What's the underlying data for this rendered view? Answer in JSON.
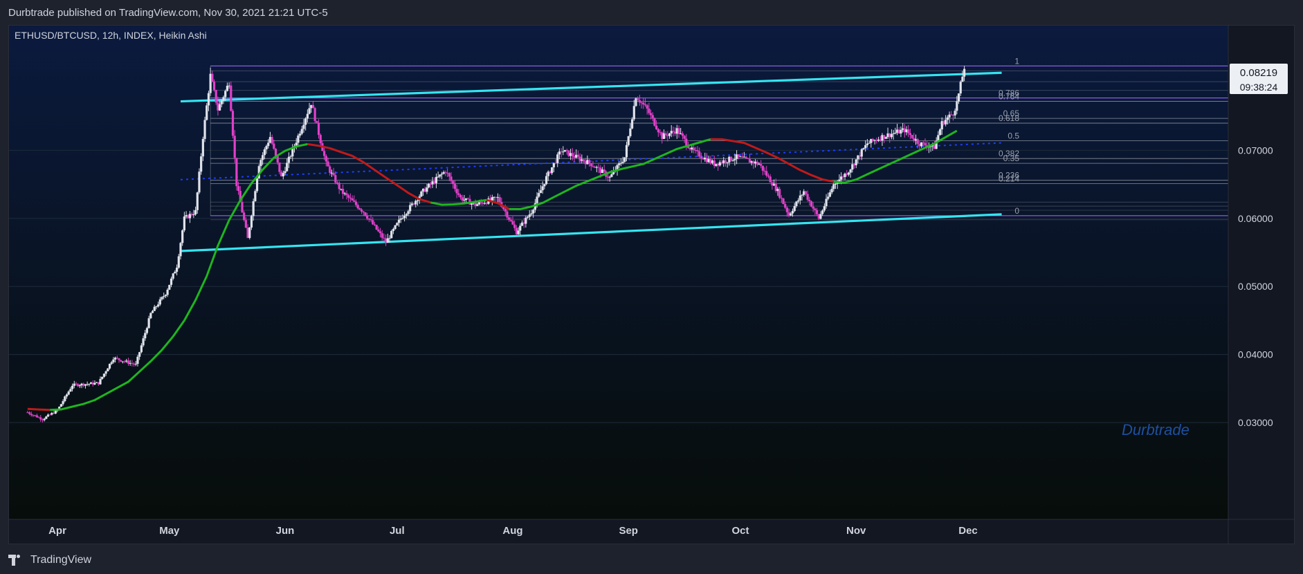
{
  "header": {
    "published": "Durbtrade published on TradingView.com, Nov 30, 2021 21:21 UTC-5"
  },
  "footer": {
    "logo_text": "TradingView"
  },
  "colors": {
    "background_top": "#0b1a3e",
    "background_bottom": "#070d0a",
    "bull_candle": "#e0e3eb",
    "bear_candle": "#e040c8",
    "trendline": "#35e4f0",
    "fib_line": "#b2b5be",
    "fib_key_line": "#8c5cf0",
    "midline": "#1e3cff",
    "ma_up": "#1fb51f",
    "ma_down": "#c01a1a",
    "watermark": "#1e4fa0"
  },
  "chart_data": {
    "type": "candlestick",
    "title": "ETHUSD/BTCUSD, 12h, INDEX, Heikin Ashi",
    "watermark": "Durbtrade",
    "x_labels": [
      "Apr",
      "May",
      "Jun",
      "Jul",
      "Aug",
      "Sep",
      "Oct",
      "Nov",
      "Dec"
    ],
    "y_ticks": [
      "0.03000",
      "0.04000",
      "0.05000",
      "0.06000",
      "0.07000"
    ],
    "ylim": [
      0.0282,
      0.0883
    ],
    "price_label": {
      "value": "0.08219",
      "countdown": "09:38:24"
    },
    "fib_levels": [
      {
        "label": "1",
        "value": 0.0824
      },
      {
        "label": "0.786",
        "value": 0.0777
      },
      {
        "label": "0.764",
        "value": 0.0772
      },
      {
        "label": "0.65",
        "value": 0.0747
      },
      {
        "label": "0.618",
        "value": 0.074
      },
      {
        "label": "0.5",
        "value": 0.0714
      },
      {
        "label": "0.382",
        "value": 0.0688
      },
      {
        "label": "0.35",
        "value": 0.0681
      },
      {
        "label": "0.236",
        "value": 0.0656
      },
      {
        "label": "0.214",
        "value": 0.0651
      },
      {
        "label": "0",
        "value": 0.0604
      }
    ],
    "price_path": [
      [
        "2021-03-24",
        0.0315
      ],
      [
        "2021-03-28",
        0.0305
      ],
      [
        "2021-04-01",
        0.0318
      ],
      [
        "2021-04-05",
        0.0355
      ],
      [
        "2021-04-12",
        0.0358
      ],
      [
        "2021-04-16",
        0.0395
      ],
      [
        "2021-04-22",
        0.0385
      ],
      [
        "2021-04-26",
        0.046
      ],
      [
        "2021-04-30",
        0.049
      ],
      [
        "2021-05-03",
        0.053
      ],
      [
        "2021-05-05",
        0.06
      ],
      [
        "2021-05-08",
        0.061
      ],
      [
        "2021-05-10",
        0.072
      ],
      [
        "2021-05-12",
        0.081
      ],
      [
        "2021-05-14",
        0.076
      ],
      [
        "2021-05-17",
        0.08
      ],
      [
        "2021-05-19",
        0.065
      ],
      [
        "2021-05-22",
        0.057
      ],
      [
        "2021-05-25",
        0.068
      ],
      [
        "2021-05-28",
        0.072
      ],
      [
        "2021-05-31",
        0.066
      ],
      [
        "2021-06-03",
        0.07
      ],
      [
        "2021-06-08",
        0.077
      ],
      [
        "2021-06-12",
        0.068
      ],
      [
        "2021-06-16",
        0.064
      ],
      [
        "2021-06-22",
        0.061
      ],
      [
        "2021-06-28",
        0.0565
      ],
      [
        "2021-07-02",
        0.06
      ],
      [
        "2021-07-08",
        0.064
      ],
      [
        "2021-07-14",
        0.067
      ],
      [
        "2021-07-18",
        0.063
      ],
      [
        "2021-07-22",
        0.062
      ],
      [
        "2021-07-28",
        0.063
      ],
      [
        "2021-08-02",
        0.058
      ],
      [
        "2021-08-06",
        0.061
      ],
      [
        "2021-08-10",
        0.066
      ],
      [
        "2021-08-14",
        0.07
      ],
      [
        "2021-08-22",
        0.068
      ],
      [
        "2021-08-27",
        0.066
      ],
      [
        "2021-08-31",
        0.069
      ],
      [
        "2021-09-03",
        0.078
      ],
      [
        "2021-09-06",
        0.076
      ],
      [
        "2021-09-10",
        0.072
      ],
      [
        "2021-09-14",
        0.073
      ],
      [
        "2021-09-18",
        0.07
      ],
      [
        "2021-09-24",
        0.068
      ],
      [
        "2021-09-30",
        0.069
      ],
      [
        "2021-10-06",
        0.068
      ],
      [
        "2021-10-11",
        0.064
      ],
      [
        "2021-10-14",
        0.0605
      ],
      [
        "2021-10-18",
        0.064
      ],
      [
        "2021-10-22",
        0.06
      ],
      [
        "2021-10-26",
        0.065
      ],
      [
        "2021-10-30",
        0.067
      ],
      [
        "2021-11-04",
        0.071
      ],
      [
        "2021-11-08",
        0.072
      ],
      [
        "2021-11-14",
        0.073
      ],
      [
        "2021-11-18",
        0.071
      ],
      [
        "2021-11-22",
        0.0705
      ],
      [
        "2021-11-24",
        0.074
      ],
      [
        "2021-11-27",
        0.0755
      ],
      [
        "2021-11-28",
        0.077
      ],
      [
        "2021-11-30",
        0.0822
      ]
    ],
    "moving_average": [
      [
        "2021-03-24",
        0.032
      ],
      [
        "2021-04-01",
        0.0318
      ],
      [
        "2021-04-10",
        0.033
      ],
      [
        "2021-04-20",
        0.036
      ],
      [
        "2021-04-28",
        0.04
      ],
      [
        "2021-05-04",
        0.044
      ],
      [
        "2021-05-10",
        0.05
      ],
      [
        "2021-05-14",
        0.056
      ],
      [
        "2021-05-18",
        0.061
      ],
      [
        "2021-05-24",
        0.066
      ],
      [
        "2021-05-30",
        0.0695
      ],
      [
        "2021-06-06",
        0.071
      ],
      [
        "2021-06-12",
        0.0705
      ],
      [
        "2021-06-20",
        0.069
      ],
      [
        "2021-06-28",
        0.066
      ],
      [
        "2021-07-06",
        0.063
      ],
      [
        "2021-07-12",
        0.062
      ],
      [
        "2021-07-18",
        0.0621
      ],
      [
        "2021-07-26",
        0.0628
      ],
      [
        "2021-08-01",
        0.0611
      ],
      [
        "2021-08-08",
        0.062
      ],
      [
        "2021-08-18",
        0.0648
      ],
      [
        "2021-08-28",
        0.067
      ],
      [
        "2021-09-05",
        0.068
      ],
      [
        "2021-09-14",
        0.0702
      ],
      [
        "2021-09-24",
        0.0718
      ],
      [
        "2021-10-02",
        0.0711
      ],
      [
        "2021-10-10",
        0.0692
      ],
      [
        "2021-10-18",
        0.0668
      ],
      [
        "2021-10-24",
        0.0655
      ],
      [
        "2021-10-30",
        0.0652
      ],
      [
        "2021-11-06",
        0.067
      ],
      [
        "2021-11-14",
        0.069
      ],
      [
        "2021-11-22",
        0.071
      ],
      [
        "2021-11-30",
        0.0735
      ]
    ],
    "ma_turns": [
      {
        "date": "2021-03-24",
        "direction": "down"
      },
      {
        "date": "2021-04-01",
        "direction": "up"
      },
      {
        "date": "2021-06-08",
        "direction": "down"
      },
      {
        "date": "2021-07-12",
        "direction": "up"
      },
      {
        "date": "2021-07-28",
        "direction": "down"
      },
      {
        "date": "2021-08-03",
        "direction": "up"
      },
      {
        "date": "2021-09-26",
        "direction": "down"
      },
      {
        "date": "2021-10-28",
        "direction": "up"
      }
    ],
    "trendlines": [
      {
        "from": [
          "2021-05-04",
          0.0772
        ],
        "to": [
          "2021-12-10",
          0.0814
        ]
      },
      {
        "from": [
          "2021-05-04",
          0.0552
        ],
        "to": [
          "2021-12-10",
          0.0606
        ]
      }
    ],
    "midline": {
      "from": [
        "2021-05-04",
        0.0657
      ],
      "to": [
        "2021-12-10",
        0.0711
      ]
    }
  }
}
